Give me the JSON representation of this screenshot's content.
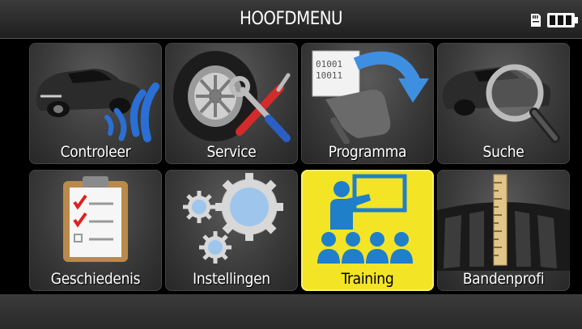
{
  "header": {
    "title": "HOOFDMENU",
    "sd_icon": "sd-card-icon",
    "battery_icon": "battery-full-icon"
  },
  "menu": {
    "selected_index": 6,
    "items": [
      {
        "label": "Controleer",
        "icon": "car-sensor-signal-icon"
      },
      {
        "label": "Service",
        "icon": "tire-tools-icon"
      },
      {
        "label": "Programma",
        "icon": "sensor-program-icon"
      },
      {
        "label": "Suche",
        "icon": "car-magnifier-icon"
      },
      {
        "label": "Geschiedenis",
        "icon": "clipboard-checklist-icon"
      },
      {
        "label": "Instellingen",
        "icon": "gears-icon"
      },
      {
        "label": "Training",
        "icon": "classroom-teacher-icon"
      },
      {
        "label": "Bandenprofi",
        "icon": "tire-tread-ruler-icon"
      }
    ]
  },
  "colors": {
    "selected_tile": "#f3e425",
    "tile_dark": "#3b3b3b",
    "signal_blue": "#2a6fd6",
    "training_blue": "#1f7fc9"
  }
}
